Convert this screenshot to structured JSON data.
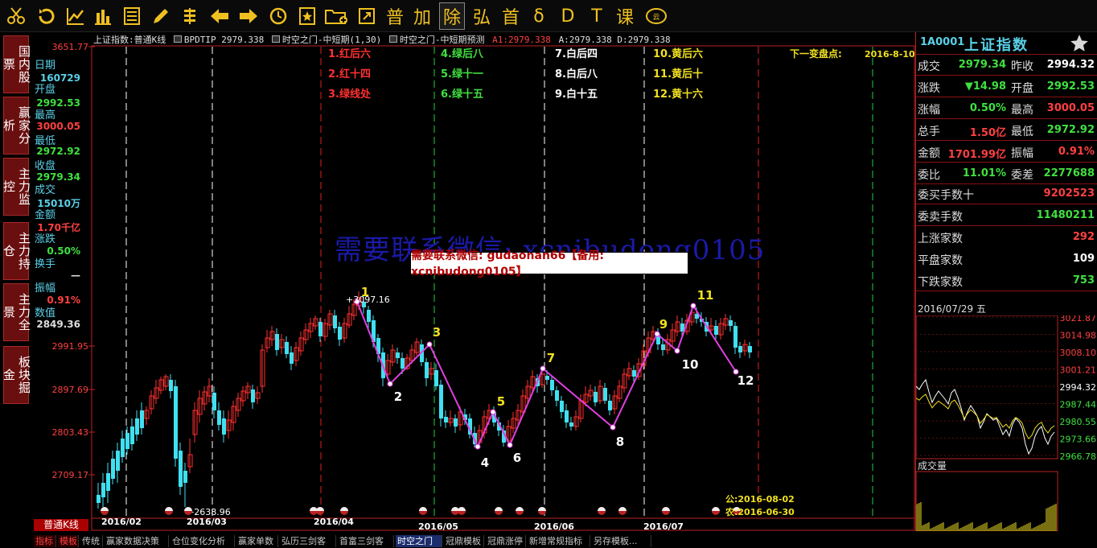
{
  "toolbar": {
    "icons": [
      "scissors-icon",
      "refresh-icon",
      "line-chart-icon",
      "bar-chart-icon",
      "list-icon",
      "pencil-icon",
      "abacus-icon",
      "arrow-left-icon",
      "arrow-right-icon",
      "clock-icon",
      "star-doc-icon",
      "folder-add-icon",
      "export-icon"
    ],
    "text_buttons": [
      "普",
      "加",
      "除",
      "弘",
      "首",
      "δ",
      "D",
      "T",
      "课"
    ],
    "active_text": "除"
  },
  "leftnav": [
    "国内股票",
    "赢家分析",
    "主力监控",
    "主力持仓",
    "主力全景",
    "板块掘金"
  ],
  "infopanel": {
    "date_label": "日期",
    "date_value": "160729",
    "open_label": "开盘",
    "open_value": "2992.53",
    "high_label": "最高",
    "high_value": "3000.05",
    "low_label": "最低",
    "low_value": "2972.92",
    "close_label": "收盘",
    "close_value": "2979.34",
    "volume_label": "成交",
    "volume_value": "15010万",
    "amount_label": "金额",
    "amount_value": "1.70千亿",
    "change_label": "涨跌",
    "change_value": "0.50%",
    "turnover_label": "换手",
    "turnover_value": "—",
    "amplitude_label": "振幅",
    "amplitude_value": "0.91%",
    "count_label": "数值",
    "count_value": "2849.36"
  },
  "chart": {
    "title": "上证指数:普通K线",
    "ind1": "BPDTIP 2979.338",
    "ind2": "时空之门-中短期(1,30)",
    "ind3": "时空之门-中短期预测",
    "ind3_a1": "A1:2979.338",
    "ind3_rest": "A:2979.338 D:2979.338",
    "yticks": [
      "3651.77",
      "2991.95",
      "2897.69",
      "2803.43",
      "2709.17"
    ],
    "date_labels": [
      "2016/02",
      "2016/03",
      "2016/04",
      "2016/05",
      "2016/06",
      "2016/07"
    ],
    "legend_red": [
      "1.红后六",
      "2.红十四",
      "3.绿线处"
    ],
    "legend_green": [
      "4.绿后八",
      "5.绿十一",
      "6.绿十五"
    ],
    "legend_white": [
      "7.白后四",
      "8.白后八",
      "9.白十五"
    ],
    "legend_yellow": [
      "10.黄后六",
      "11.黄后十",
      "12.黄十六"
    ],
    "next_label": "下一变盘点:",
    "next_date": "2016-8-10",
    "peak_label": "3097.16",
    "low_label": "2638.96",
    "wave_numbers": [
      "1",
      "2",
      "3",
      "4",
      "5",
      "6",
      "7",
      "8",
      "9",
      "10",
      "11",
      "12"
    ],
    "gong_label": "公:2016-08-02",
    "nong_label": "农:2016-06-30",
    "watermark": "需要联系微信: xcnibudong0105",
    "prompt": "需要联系微信: gudaonan66【备用: xcnibudong0105】",
    "colors": {
      "up": "#ff3030",
      "down": "#40e0f0",
      "magenta": "#e040e0",
      "red_line": "#e02020",
      "green_line": "#20d040",
      "white_line": "#ffffff"
    }
  },
  "bottom_tabs": [
    "指标",
    "模板",
    "传统",
    "赢家数据决策",
    "仓位变化分析",
    "赢家单数",
    "弘历三剑客",
    "首富三剑客",
    "时空之门",
    "冠鼎模板",
    "冠鼎涨停",
    "新增常规指标",
    "另存模板..."
  ],
  "bottom_left": "普通K线",
  "active_tab": "时空之门",
  "right": {
    "code": "1A0001",
    "name": "上证指数",
    "rows": [
      {
        "l": "成交",
        "lv": "2979.34",
        "lc": "#40e040",
        "r": "昨收",
        "rv": "2994.32",
        "rc": "#ffffff"
      },
      {
        "l": "涨跌",
        "lv": "▼14.98",
        "lc": "#40e040",
        "r": "开盘",
        "rv": "2992.53",
        "rc": "#40e040"
      },
      {
        "l": "涨幅",
        "lv": "0.50%",
        "lc": "#40e040",
        "r": "最高",
        "rv": "3000.05",
        "rc": "#ff4040"
      },
      {
        "l": "总手",
        "lv": "1.50亿",
        "lc": "#ff4040",
        "r": "最低",
        "rv": "2972.92",
        "rc": "#40e040"
      },
      {
        "l": "金额",
        "lv": "1701.99亿",
        "lc": "#ff4040",
        "r": "振幅",
        "rv": "0.91%",
        "rc": "#ff4040"
      },
      {
        "l": "委比",
        "lv": "11.01%",
        "lc": "#40e040",
        "r": "委差",
        "rv": "2277688",
        "rc": "#40e040"
      }
    ],
    "buy_label": "委买手数十",
    "buy_value": "9202523",
    "sell_label": "委卖手数",
    "sell_value": "11480211",
    "up_label": "上涨家数",
    "up_value": "292",
    "flat_label": "平盘家数",
    "flat_value": "109",
    "down_label": "下跌家数",
    "down_value": "753",
    "date": "2016/07/29 五",
    "price_ticks": [
      "3021.87",
      "3014.98",
      "3008.10",
      "3001.21",
      "2994.32",
      "2987.44",
      "2980.55",
      "2973.66",
      "2966.78"
    ],
    "volume_label": "成交量"
  }
}
